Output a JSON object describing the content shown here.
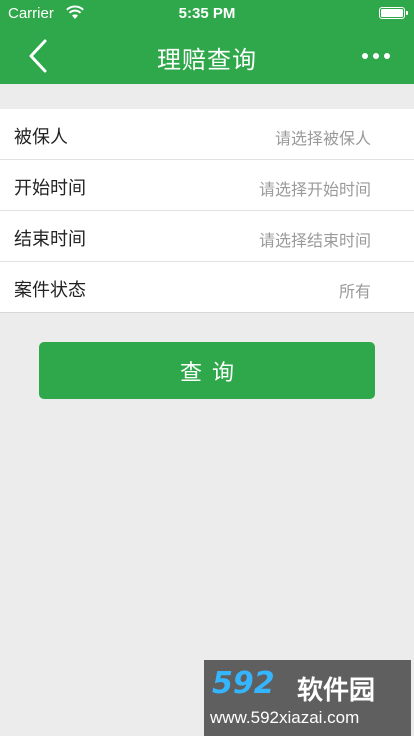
{
  "status_bar": {
    "carrier": "Carrier",
    "time": "5:35 PM"
  },
  "nav": {
    "title": "理赔查询",
    "back_icon": "chevron-left-icon",
    "more_icon": "more-horizontal-icon"
  },
  "form": {
    "rows": [
      {
        "label": "被保人",
        "value": "请选择被保人"
      },
      {
        "label": "开始时间",
        "value": "请选择开始时间"
      },
      {
        "label": "结束时间",
        "value": "请选择结束时间"
      },
      {
        "label": "案件状态",
        "value": "所有"
      }
    ]
  },
  "query_button": {
    "label": "查询"
  },
  "watermark": {
    "logo": "592",
    "brand": "软件园",
    "url": "www.592xiazai.com"
  },
  "colors": {
    "primary": "#2ea84a",
    "background": "#ececec",
    "placeholder": "#9a9a9a"
  }
}
